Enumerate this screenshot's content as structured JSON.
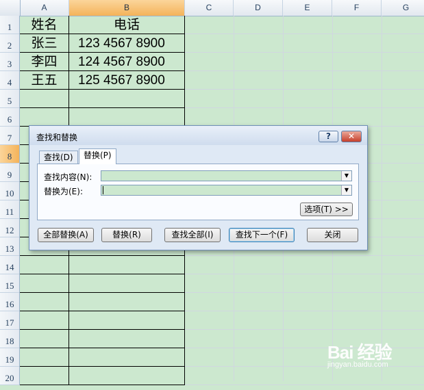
{
  "columns": [
    {
      "id": "A",
      "label": "A"
    },
    {
      "id": "B",
      "label": "B"
    },
    {
      "id": "C",
      "label": "C"
    },
    {
      "id": "D",
      "label": "D"
    },
    {
      "id": "E",
      "label": "E"
    },
    {
      "id": "F",
      "label": "F"
    },
    {
      "id": "G",
      "label": "G"
    }
  ],
  "rows": [
    "1",
    "2",
    "3",
    "4",
    "5",
    "6",
    "7",
    "8",
    "9",
    "10",
    "11",
    "12",
    "13",
    "14",
    "15",
    "16",
    "17",
    "18",
    "19",
    "20"
  ],
  "selected_column": "B",
  "selected_row": "8",
  "cells": [
    {
      "a": "姓名",
      "b": "电话"
    },
    {
      "a": "张三",
      "b": "123  4567  8900"
    },
    {
      "a": "李四",
      "b": "124  4567  8900"
    },
    {
      "a": "王五",
      "b": "125  4567  8900"
    }
  ],
  "dialog": {
    "title": "查找和替换",
    "help_label": "?",
    "close_label": "✕",
    "tabs": [
      {
        "label": "查找(D)",
        "active": false
      },
      {
        "label": "替换(P)",
        "active": true
      }
    ],
    "find_label": "查找内容(N):",
    "find_value": "",
    "replace_label": "替换为(E):",
    "replace_value": "",
    "options_label": "选项(T) >>",
    "buttons": {
      "replace_all": "全部替换(A)",
      "replace": "替换(R)",
      "find_all": "查找全部(I)",
      "find_next": "查找下一个(F)",
      "close": "关闭"
    }
  },
  "watermark": {
    "text": "Bai 经验",
    "sub": "jingyan.baidu.com"
  },
  "colors": {
    "sheet_bg": "#cce8cf",
    "selected_header": "#f4b35a"
  }
}
